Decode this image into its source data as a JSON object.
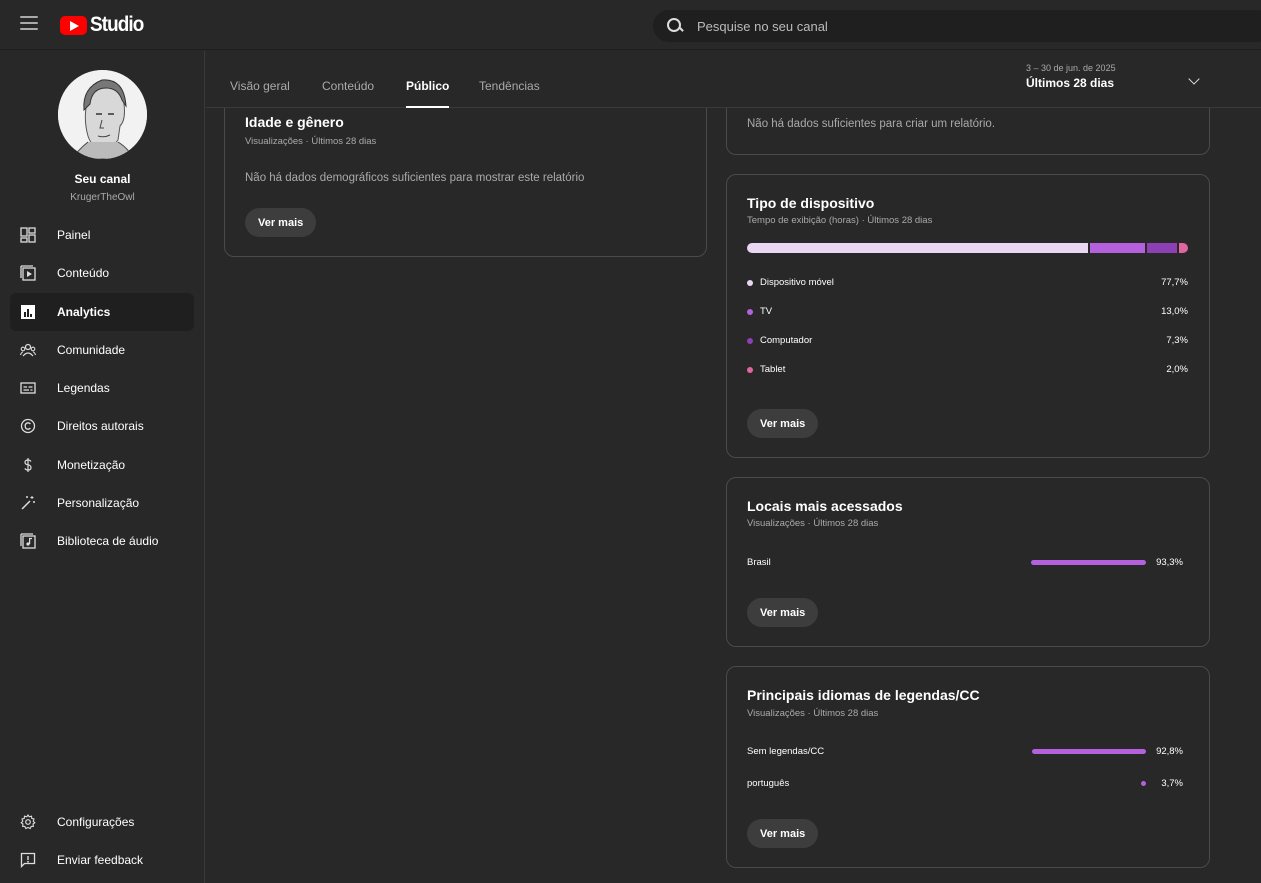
{
  "header": {
    "logo_text": "Studio",
    "search_placeholder": "Pesquise no seu canal"
  },
  "sidebar": {
    "channel_name": "Seu canal",
    "channel_handle": "KrugerTheOwl",
    "items": [
      {
        "label": "Painel",
        "icon": "dashboard-icon"
      },
      {
        "label": "Conteúdo",
        "icon": "content-icon"
      },
      {
        "label": "Analytics",
        "icon": "analytics-icon",
        "active": true
      },
      {
        "label": "Comunidade",
        "icon": "community-icon"
      },
      {
        "label": "Legendas",
        "icon": "subtitles-icon"
      },
      {
        "label": "Direitos autorais",
        "icon": "copyright-icon"
      },
      {
        "label": "Monetização",
        "icon": "dollar-icon"
      },
      {
        "label": "Personalização",
        "icon": "magic-wand-icon"
      },
      {
        "label": "Biblioteca de áudio",
        "icon": "audio-library-icon"
      }
    ],
    "bottom_items": [
      {
        "label": "Configurações",
        "icon": "gear-icon"
      },
      {
        "label": "Enviar feedback",
        "icon": "feedback-icon"
      }
    ]
  },
  "tabs": [
    {
      "label": "Visão geral"
    },
    {
      "label": "Conteúdo"
    },
    {
      "label": "Público",
      "active": true
    },
    {
      "label": "Tendências"
    }
  ],
  "date_range": {
    "range": "3 – 30 de jun. de 2025",
    "label": "Últimos 28 dias"
  },
  "cards": {
    "age_gender": {
      "title": "Idade e gênero",
      "subtitle": "Visualizações · Últimos 28 dias",
      "message": "Não há dados demográficos suficientes para mostrar este relatório",
      "button": "Ver mais"
    },
    "top_card": {
      "message": "Não há dados suficientes para criar um relatório."
    },
    "device_type": {
      "title": "Tipo de dispositivo",
      "subtitle": "Tempo de exibição (horas) · Últimos 28 dias",
      "items": [
        {
          "label": "Dispositivo móvel",
          "value": "77,7%",
          "pct": 77.7,
          "color": "#e9d6f2"
        },
        {
          "label": "TV",
          "value": "13,0%",
          "pct": 13.0,
          "color": "#b561dd"
        },
        {
          "label": "Computador",
          "value": "7,3%",
          "pct": 7.3,
          "color": "#8d3fb4"
        },
        {
          "label": "Tablet",
          "value": "2,0%",
          "pct": 2.0,
          "color": "#e0669f"
        }
      ],
      "button": "Ver mais"
    },
    "top_locations": {
      "title": "Locais mais acessados",
      "subtitle": "Visualizações · Últimos 28 dias",
      "items": [
        {
          "label": "Brasil",
          "value": "93,3%",
          "pct": 93.3
        }
      ],
      "button": "Ver mais"
    },
    "subtitle_languages": {
      "title": "Principais idiomas de legendas/CC",
      "subtitle": "Visualizações · Últimos 28 dias",
      "items": [
        {
          "label": "Sem legendas/CC",
          "value": "92,8%",
          "pct": 92.8
        },
        {
          "label": "português",
          "value": "3,7%",
          "pct": 3.7
        }
      ],
      "button": "Ver mais"
    }
  },
  "colors": {
    "accent": "#b561dd",
    "background": "#282828"
  }
}
